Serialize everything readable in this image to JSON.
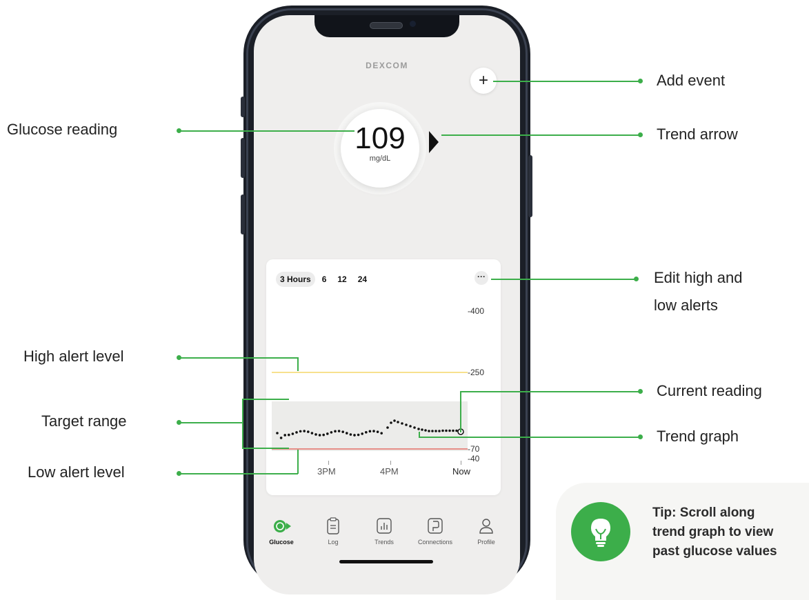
{
  "app": {
    "brand": "DEXCOM",
    "add_button_glyph": "+",
    "reading": {
      "value": "109",
      "unit": "mg/dL"
    },
    "graph": {
      "range_tabs": [
        "3 Hours",
        "6",
        "12",
        "24"
      ],
      "active_range": "3 Hours",
      "menu_glyph": "···",
      "y_labels": [
        "-400",
        "-250",
        "-70",
        "-40"
      ],
      "x_labels": [
        "3PM",
        "4PM",
        "Now"
      ],
      "high_alert_color": "#f2cf4a",
      "low_alert_color": "#e2554c",
      "target_range_color": "#ececea"
    },
    "nav": [
      {
        "label": "Glucose",
        "icon": "glucose-drop-icon"
      },
      {
        "label": "Log",
        "icon": "clipboard-icon"
      },
      {
        "label": "Trends",
        "icon": "bar-chart-icon"
      },
      {
        "label": "Connections",
        "icon": "connections-icon"
      },
      {
        "label": "Profile",
        "icon": "person-icon"
      }
    ]
  },
  "annotations": {
    "left": [
      "Glucose reading",
      "High alert level",
      "Target range",
      "Low alert level"
    ],
    "right": [
      "Add event",
      "Trend arrow",
      "Edit high and",
      "low alerts",
      "Current reading",
      "Trend graph"
    ]
  },
  "tip": {
    "prefix": "Tip:",
    "line1": "Scroll along",
    "line2": "trend graph to view",
    "line3": "past glucose values"
  },
  "colors": {
    "accent": "#3cae4a",
    "phone": "#1b1f27",
    "screen": "#efeeed"
  }
}
